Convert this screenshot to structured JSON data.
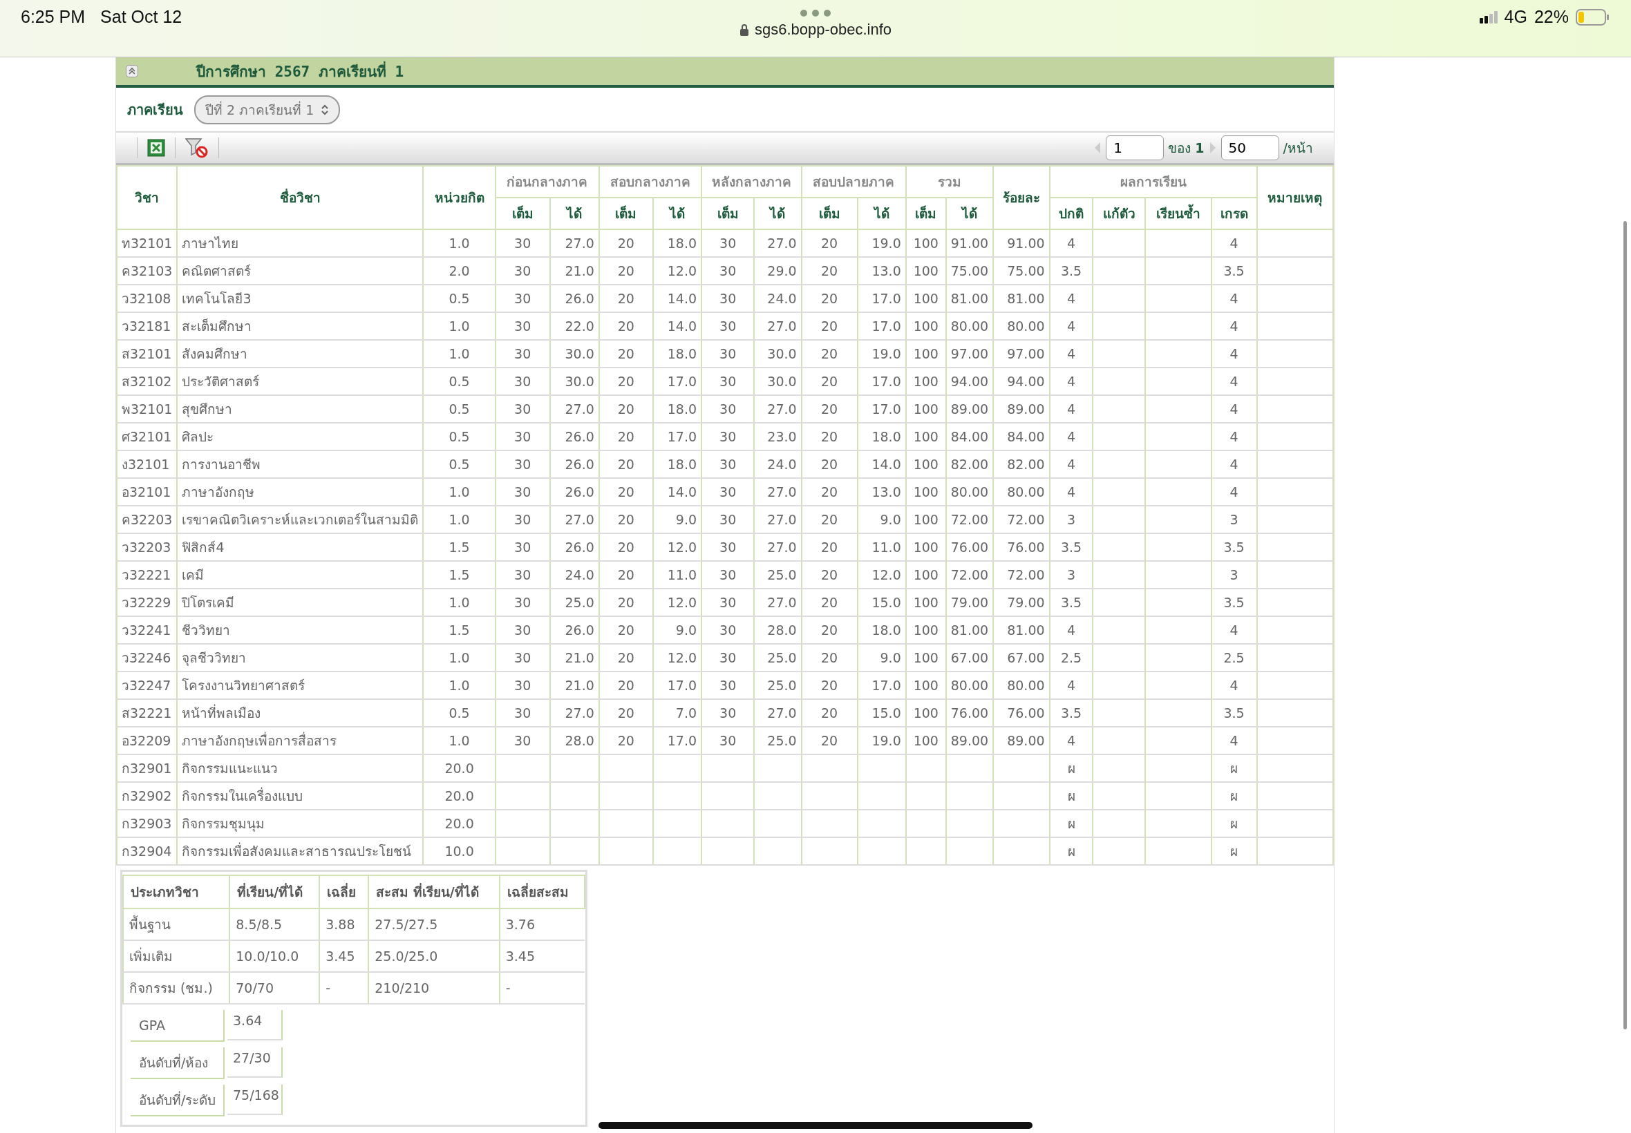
{
  "status_bar": {
    "time": "6:25 PM",
    "date": "Sat Oct 12",
    "url": "sgs6.bopp-obec.info",
    "network": "4G",
    "battery": "22%"
  },
  "panel": {
    "title": "ปีการศึกษา 2567 ภาคเรียนที่ 1",
    "expanded": true
  },
  "semester": {
    "label": "ภาคเรียน",
    "value": "ปีที่ 2 ภาคเรียนที่ 1"
  },
  "pager": {
    "page": "1",
    "of": "ของ **1**",
    "per_page": "50",
    "per_page_label": "/หน้า"
  },
  "table": {
    "lead_columns": [
      "วิชา",
      "ชื่อวิชา",
      "หน่วยกิต"
    ],
    "score_groups": [
      {
        "label": "ก่อนกลางภาค",
        "sub": [
          "เต็ม",
          "ได้"
        ]
      },
      {
        "label": "สอบกลางภาค",
        "sub": [
          "เต็ม",
          "ได้"
        ]
      },
      {
        "label": "หลังกลางภาค",
        "sub": [
          "เต็ม",
          "ได้"
        ]
      },
      {
        "label": "สอบปลายภาค",
        "sub": [
          "เต็ม",
          "ได้"
        ]
      },
      {
        "label": "รวม",
        "sub": [
          "เต็ม",
          "ได้"
        ]
      }
    ],
    "percent_column": "ร้อยละ",
    "result_group": {
      "label": "ผลการเรียน",
      "sub": [
        "ปกติ",
        "แก้ตัว",
        "เรียนซ้ำ",
        "เกรด"
      ]
    },
    "note_column": "หมายเหตุ",
    "rows": [
      {
        "code": "ท32101",
        "name": "ภาษาไทย",
        "credits": "1.0",
        "scores": [
          "30",
          "27.0",
          "20",
          "18.0",
          "30",
          "27.0",
          "20",
          "19.0",
          "100",
          "91.00"
        ],
        "percent": "91.00",
        "normal": "4",
        "grade": "4"
      },
      {
        "code": "ค32103",
        "name": "คณิตศาสตร์",
        "credits": "2.0",
        "scores": [
          "30",
          "21.0",
          "20",
          "12.0",
          "30",
          "29.0",
          "20",
          "13.0",
          "100",
          "75.00"
        ],
        "percent": "75.00",
        "normal": "3.5",
        "grade": "3.5"
      },
      {
        "code": "ว32108",
        "name": "เทคโนโลยี3",
        "credits": "0.5",
        "scores": [
          "30",
          "26.0",
          "20",
          "14.0",
          "30",
          "24.0",
          "20",
          "17.0",
          "100",
          "81.00"
        ],
        "percent": "81.00",
        "normal": "4",
        "grade": "4"
      },
      {
        "code": "ว32181",
        "name": "สะเต็มศึกษา",
        "credits": "1.0",
        "scores": [
          "30",
          "22.0",
          "20",
          "14.0",
          "30",
          "27.0",
          "20",
          "17.0",
          "100",
          "80.00"
        ],
        "percent": "80.00",
        "normal": "4",
        "grade": "4"
      },
      {
        "code": "ส32101",
        "name": "สังคมศึกษา",
        "credits": "1.0",
        "scores": [
          "30",
          "30.0",
          "20",
          "18.0",
          "30",
          "30.0",
          "20",
          "19.0",
          "100",
          "97.00"
        ],
        "percent": "97.00",
        "normal": "4",
        "grade": "4"
      },
      {
        "code": "ส32102",
        "name": "ประวัติศาสตร์",
        "credits": "0.5",
        "scores": [
          "30",
          "30.0",
          "20",
          "17.0",
          "30",
          "30.0",
          "20",
          "17.0",
          "100",
          "94.00"
        ],
        "percent": "94.00",
        "normal": "4",
        "grade": "4"
      },
      {
        "code": "พ32101",
        "name": "สุขศึกษา",
        "credits": "0.5",
        "scores": [
          "30",
          "27.0",
          "20",
          "18.0",
          "30",
          "27.0",
          "20",
          "17.0",
          "100",
          "89.00"
        ],
        "percent": "89.00",
        "normal": "4",
        "grade": "4"
      },
      {
        "code": "ศ32101",
        "name": "ศิลปะ",
        "credits": "0.5",
        "scores": [
          "30",
          "26.0",
          "20",
          "17.0",
          "30",
          "23.0",
          "20",
          "18.0",
          "100",
          "84.00"
        ],
        "percent": "84.00",
        "normal": "4",
        "grade": "4"
      },
      {
        "code": "ง32101",
        "name": "การงานอาชีพ",
        "credits": "0.5",
        "scores": [
          "30",
          "26.0",
          "20",
          "18.0",
          "30",
          "24.0",
          "20",
          "14.0",
          "100",
          "82.00"
        ],
        "percent": "82.00",
        "normal": "4",
        "grade": "4"
      },
      {
        "code": "อ32101",
        "name": "ภาษาอังกฤษ",
        "credits": "1.0",
        "scores": [
          "30",
          "26.0",
          "20",
          "14.0",
          "30",
          "27.0",
          "20",
          "13.0",
          "100",
          "80.00"
        ],
        "percent": "80.00",
        "normal": "4",
        "grade": "4"
      },
      {
        "code": "ค32203",
        "name": "เรขาคณิตวิเคราะห์และเวกเตอร์ในสามมิติ",
        "credits": "1.0",
        "scores": [
          "30",
          "27.0",
          "20",
          "9.0",
          "30",
          "27.0",
          "20",
          "9.0",
          "100",
          "72.00"
        ],
        "percent": "72.00",
        "normal": "3",
        "grade": "3"
      },
      {
        "code": "ว32203",
        "name": "ฟิสิกส์4",
        "credits": "1.5",
        "scores": [
          "30",
          "26.0",
          "20",
          "12.0",
          "30",
          "27.0",
          "20",
          "11.0",
          "100",
          "76.00"
        ],
        "percent": "76.00",
        "normal": "3.5",
        "grade": "3.5"
      },
      {
        "code": "ว32221",
        "name": "เคมี",
        "credits": "1.5",
        "scores": [
          "30",
          "24.0",
          "20",
          "11.0",
          "30",
          "25.0",
          "20",
          "12.0",
          "100",
          "72.00"
        ],
        "percent": "72.00",
        "normal": "3",
        "grade": "3"
      },
      {
        "code": "ว32229",
        "name": "ปิโตรเคมี",
        "credits": "1.0",
        "scores": [
          "30",
          "25.0",
          "20",
          "12.0",
          "30",
          "27.0",
          "20",
          "15.0",
          "100",
          "79.00"
        ],
        "percent": "79.00",
        "normal": "3.5",
        "grade": "3.5"
      },
      {
        "code": "ว32241",
        "name": "ชีววิทยา",
        "credits": "1.5",
        "scores": [
          "30",
          "26.0",
          "20",
          "9.0",
          "30",
          "28.0",
          "20",
          "18.0",
          "100",
          "81.00"
        ],
        "percent": "81.00",
        "normal": "4",
        "grade": "4"
      },
      {
        "code": "ว32246",
        "name": "จุลชีววิทยา",
        "credits": "1.0",
        "scores": [
          "30",
          "21.0",
          "20",
          "12.0",
          "30",
          "25.0",
          "20",
          "9.0",
          "100",
          "67.00"
        ],
        "percent": "67.00",
        "normal": "2.5",
        "grade": "2.5"
      },
      {
        "code": "ว32247",
        "name": "โครงงานวิทยาศาสตร์",
        "credits": "1.0",
        "scores": [
          "30",
          "21.0",
          "20",
          "17.0",
          "30",
          "25.0",
          "20",
          "17.0",
          "100",
          "80.00"
        ],
        "percent": "80.00",
        "normal": "4",
        "grade": "4"
      },
      {
        "code": "ส32221",
        "name": "หน้าที่พลเมือง",
        "credits": "0.5",
        "scores": [
          "30",
          "27.0",
          "20",
          "7.0",
          "30",
          "27.0",
          "20",
          "15.0",
          "100",
          "76.00"
        ],
        "percent": "76.00",
        "normal": "3.5",
        "grade": "3.5"
      },
      {
        "code": "อ32209",
        "name": "ภาษาอังกฤษเพื่อการสื่อสาร",
        "credits": "1.0",
        "scores": [
          "30",
          "28.0",
          "20",
          "17.0",
          "30",
          "25.0",
          "20",
          "19.0",
          "100",
          "89.00"
        ],
        "percent": "89.00",
        "normal": "4",
        "grade": "4"
      },
      {
        "code": "ก32901",
        "name": "กิจกรรมแนะแนว",
        "credits": "20.0",
        "normal": "ผ",
        "grade": "ผ"
      },
      {
        "code": "ก32902",
        "name": "กิจกรรมในเครื่องแบบ",
        "credits": "20.0",
        "normal": "ผ",
        "grade": "ผ"
      },
      {
        "code": "ก32903",
        "name": "กิจกรรมชุมนุม",
        "credits": "20.0",
        "normal": "ผ",
        "grade": "ผ"
      },
      {
        "code": "ก32904",
        "name": "กิจกรรมเพื่อสังคมและสาธารณประโยชน์",
        "credits": "10.0",
        "normal": "ผ",
        "grade": "ผ"
      }
    ]
  },
  "summary": {
    "columns": [
      "ประเภทวิชา",
      "ที่เรียน/ที่ได้",
      "เฉลี่ย",
      "สะสม ที่เรียน/ที่ได้",
      "เฉลี่ยสะสม"
    ],
    "rows": [
      [
        "พื้นฐาน",
        "8.5/8.5",
        "3.88",
        "27.5/27.5",
        "3.76"
      ],
      [
        "เพิ่มเติม",
        "10.0/10.0",
        "3.45",
        "25.0/25.0",
        "3.45"
      ],
      [
        "กิจกรรม (ชม.)",
        "70/70",
        "-",
        "210/210",
        "-"
      ]
    ],
    "stats": [
      {
        "label": "GPA",
        "value": "3.64"
      },
      {
        "label": "อันดับที่/ห้อง",
        "value": "27/30"
      },
      {
        "label": "อันดับที่/ระดับ",
        "value": "75/168"
      }
    ]
  }
}
